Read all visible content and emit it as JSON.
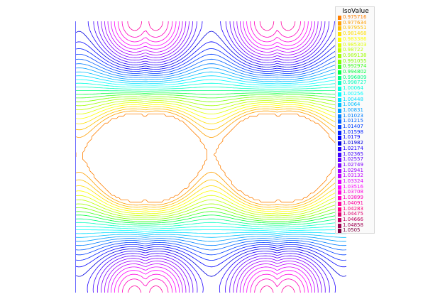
{
  "chart_data": {
    "type": "contour",
    "title": "",
    "xlabel": "",
    "ylabel": "",
    "grid": false,
    "legend": {
      "title": "IsoValue",
      "placement": "top-right"
    },
    "levels": [
      {
        "value": "0.975716",
        "color": "#ff7f00"
      },
      {
        "value": "0.977634",
        "color": "#ff9f00"
      },
      {
        "value": "0.979551",
        "color": "#ffbf00"
      },
      {
        "value": "0.981468",
        "color": "#ffdf00"
      },
      {
        "value": "0.983386",
        "color": "#ffff00"
      },
      {
        "value": "0.985303",
        "color": "#dfff00"
      },
      {
        "value": "0.98722",
        "color": "#bfff00"
      },
      {
        "value": "0.989138",
        "color": "#9fff00"
      },
      {
        "value": "0.991055",
        "color": "#7fff00"
      },
      {
        "value": "0.992974",
        "color": "#3fff20"
      },
      {
        "value": "0.994802",
        "color": "#00ff40"
      },
      {
        "value": "0.996809",
        "color": "#00ff80"
      },
      {
        "value": "0.998727",
        "color": "#00ffbf"
      },
      {
        "value": "1.00064",
        "color": "#00ffdf"
      },
      {
        "value": "1.00256",
        "color": "#00ffff"
      },
      {
        "value": "1.00448",
        "color": "#00dfff"
      },
      {
        "value": "1.0064",
        "color": "#00bfff"
      },
      {
        "value": "1.00831",
        "color": "#009fff"
      },
      {
        "value": "1.01023",
        "color": "#007fff"
      },
      {
        "value": "1.01215",
        "color": "#005fff"
      },
      {
        "value": "1.01407",
        "color": "#003fff"
      },
      {
        "value": "1.01598",
        "color": "#001fff"
      },
      {
        "value": "1.0179",
        "color": "#0000ff"
      },
      {
        "value": "1.01982",
        "color": "#0000df"
      },
      {
        "value": "1.02174",
        "color": "#1f00ff"
      },
      {
        "value": "1.02365",
        "color": "#3f00ff"
      },
      {
        "value": "1.02557",
        "color": "#5f00ff"
      },
      {
        "value": "1.02749",
        "color": "#7f00ff"
      },
      {
        "value": "1.02941",
        "color": "#9f00ff"
      },
      {
        "value": "1.03132",
        "color": "#bf00ff"
      },
      {
        "value": "1.03324",
        "color": "#df00ff"
      },
      {
        "value": "1.03516",
        "color": "#ff00ff"
      },
      {
        "value": "1.03708",
        "color": "#ff00df"
      },
      {
        "value": "1.03899",
        "color": "#ff00bf"
      },
      {
        "value": "1.04091",
        "color": "#ff009f"
      },
      {
        "value": "1.04283",
        "color": "#ff007f"
      },
      {
        "value": "1.04475",
        "color": "#df0070"
      },
      {
        "value": "1.04666",
        "color": "#bf0060"
      },
      {
        "value": "1.04858",
        "color": "#9f0050"
      },
      {
        "value": "1.0505",
        "color": "#7f0040"
      }
    ]
  }
}
